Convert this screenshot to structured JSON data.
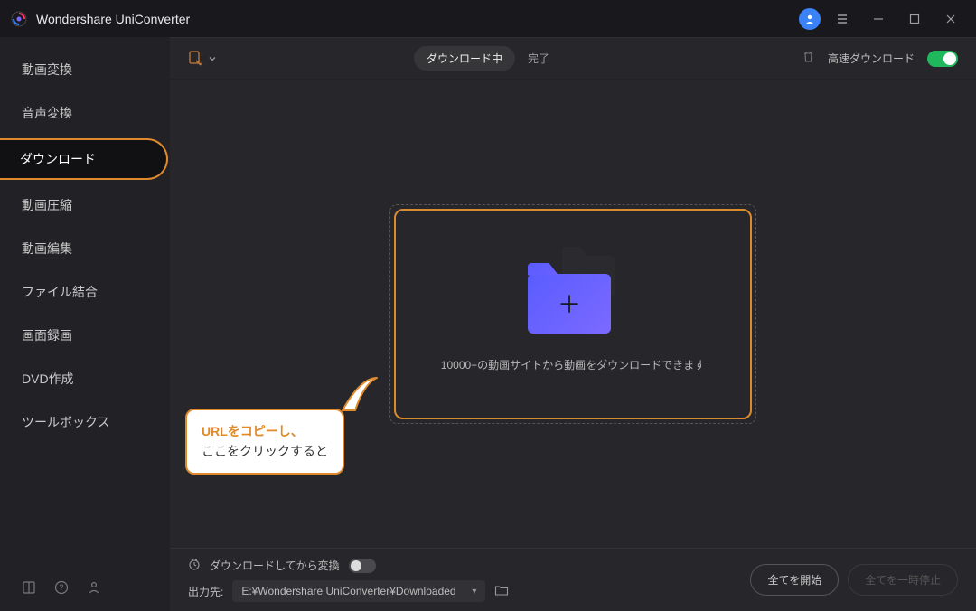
{
  "app": {
    "title": "Wondershare UniConverter"
  },
  "sidebar": {
    "items": [
      {
        "label": "動画変換"
      },
      {
        "label": "音声変換"
      },
      {
        "label": "ダウンロード"
      },
      {
        "label": "動画圧縮"
      },
      {
        "label": "動画編集"
      },
      {
        "label": "ファイル結合"
      },
      {
        "label": "画面録画"
      },
      {
        "label": "DVD作成"
      },
      {
        "label": "ツールボックス"
      }
    ]
  },
  "topbar": {
    "tab_downloading": "ダウンロード中",
    "tab_done": "完了",
    "high_speed_label": "高速ダウンロード"
  },
  "dropzone": {
    "description": "10000+の動画サイトから動画をダウンロードできます"
  },
  "callout": {
    "line1": "URLをコピーし、",
    "line2": "ここをクリックすると"
  },
  "bottombar": {
    "convert_after_dl": "ダウンロードしてから変換",
    "output_label": "出力先:",
    "output_path": "E:¥Wondershare UniConverter¥Downloaded",
    "start_all": "全てを開始",
    "pause_all": "全てを一時停止"
  }
}
